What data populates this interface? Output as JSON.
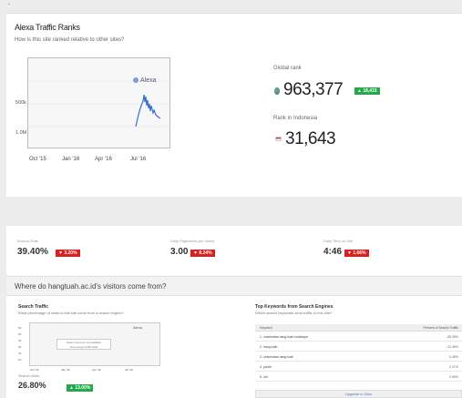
{
  "header": {
    "corner_mark": "-"
  },
  "traffic_ranks": {
    "title": "Alexa Traffic Ranks",
    "subtitle": "How is this site ranked relative to other sites?",
    "chart": {
      "logo": "Alexa",
      "y_ticks": [
        "500k",
        "1.0M"
      ],
      "x_ticks": [
        "Oct '15",
        "Jan '16",
        "Apr '16",
        "Jul '16"
      ]
    },
    "global": {
      "label": "Global rank",
      "value": "963,377",
      "delta": "▲ 18,415",
      "delta_color": "#24a84a"
    },
    "country": {
      "label": "Rank in Indonesia",
      "value": "31,643"
    }
  },
  "metrics": [
    {
      "label": "Bounce Rate",
      "value": "39.40%",
      "delta": "▼ 3.20%"
    },
    {
      "label": "Daily Pageviews per Visitor",
      "value": "3.00",
      "delta": "▼ 8.24%"
    },
    {
      "label": "Daily Time on Site",
      "value": "4:46",
      "delta": "▼ 1.66%"
    }
  ],
  "visitors_section": {
    "title": "Where do hangtuah.ac.id's visitors come from?"
  },
  "search_traffic": {
    "title": "Search Traffic",
    "subtitle": "What percentage of visits to this site come from a search engine?",
    "logo": "Alexa",
    "overlay_line1": "Search percent not available",
    "overlay_line2": "Not enough traffic data",
    "y_ticks": [
      "60",
      "50",
      "40",
      "30",
      "20",
      "10"
    ],
    "x_ticks": [
      "Oct '15",
      "Jan '16",
      "Apr '16",
      "Jul '16"
    ],
    "visits_label": "Search Visits",
    "visits_value": "26.80%",
    "visits_delta": "▲ 13.00%"
  },
  "keywords": {
    "title": "Top Keywords from Search Engines",
    "subtitle": "Which search keywords send traffic to this site?",
    "col_keyword": "Keyword",
    "col_percent": "Percent of Search Traffic",
    "rows": [
      {
        "keyword": "1. universitas hang tuah surabaya",
        "percent": "65.35%"
      },
      {
        "keyword": "2. hang tuah",
        "percent": "22.45%"
      },
      {
        "keyword": "3. universitas hang tuah",
        "percent": "5.45%"
      },
      {
        "keyword": "4. pdufri",
        "percent": "2.37%"
      },
      {
        "keyword": "5. uhi",
        "percent": "2.06%"
      }
    ],
    "upgrade_label": "Upgrade to View"
  }
}
